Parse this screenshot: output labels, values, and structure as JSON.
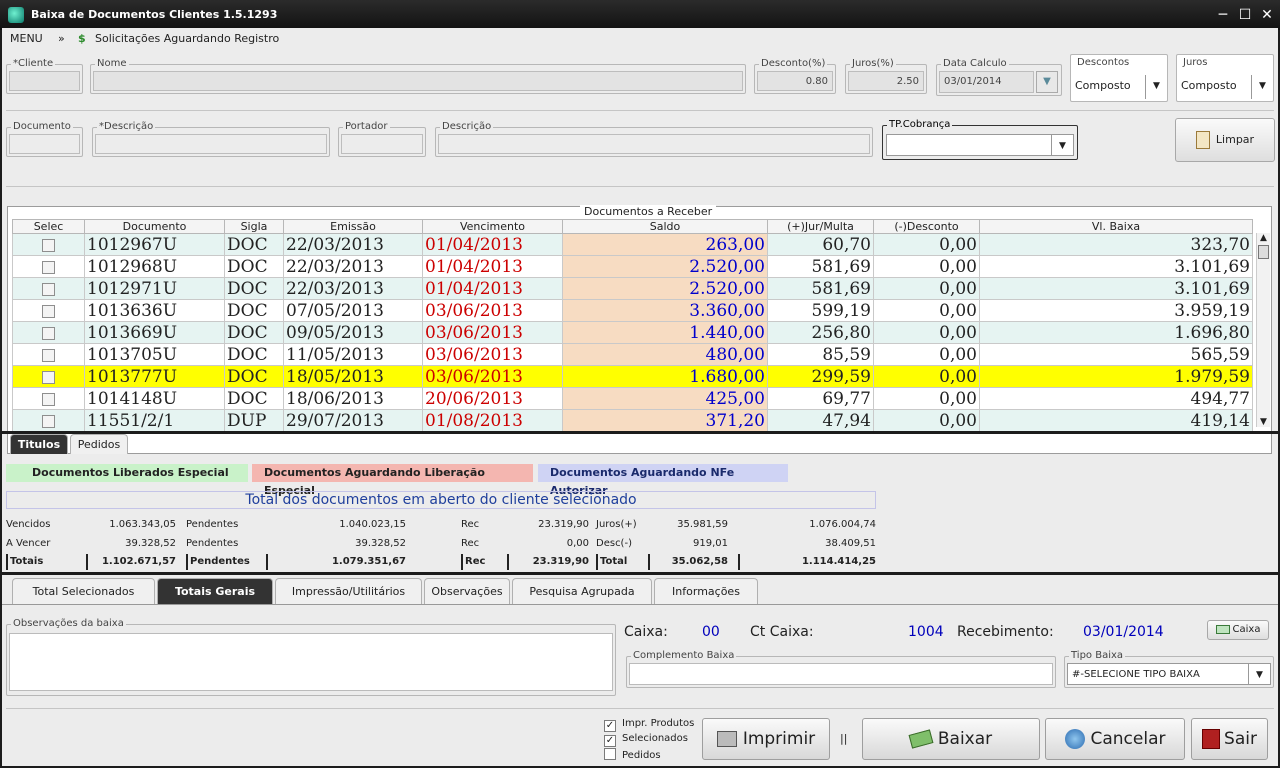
{
  "window": {
    "title": "Baixa de Documentos Clientes  1.5.1293",
    "minimize": "─",
    "maximize": "☐",
    "close": "✕"
  },
  "menu": {
    "menu_label": "MENU",
    "collapse_glyph": "»",
    "solicitacoes": "Solicitações Aguardando Registro"
  },
  "filters": {
    "cliente_label": "*Cliente",
    "cliente_value": "",
    "nome_label": "Nome",
    "nome_value": "",
    "desconto_label": "Desconto(%)",
    "desconto_value": "0.80",
    "juros_label": "Juros(%)",
    "juros_value": "2.50",
    "data_calculo_label": "Data Calculo",
    "data_calculo_value": "03/01/2014",
    "descontos_label": "Descontos",
    "descontos_value": "Composto",
    "juros_tipo_label": "Juros",
    "juros_tipo_value": "Composto",
    "documento_label": "Documento",
    "descricao_req_label": "*Descrição",
    "portador_label": "Portador",
    "descricao_label": "Descrição",
    "tp_cobranca_label": "TP.Cobrança",
    "tp_cobranca_value": "",
    "limpar_label": "Limpar"
  },
  "grid": {
    "title": "Documentos a Receber",
    "columns": [
      "Selec",
      "Documento",
      "Sigla",
      "Emissão",
      "Vencimento",
      "Saldo",
      "(+)Jur/Multa",
      "(-)Desconto",
      "Vl. Baixa"
    ],
    "rows": [
      [
        "1012967U",
        "DOC",
        "22/03/2013",
        "01/04/2013",
        "263,00",
        "60,70",
        "0,00",
        "323,70"
      ],
      [
        "1012968U",
        "DOC",
        "22/03/2013",
        "01/04/2013",
        "2.520,00",
        "581,69",
        "0,00",
        "3.101,69"
      ],
      [
        "1012971U",
        "DOC",
        "22/03/2013",
        "01/04/2013",
        "2.520,00",
        "581,69",
        "0,00",
        "3.101,69"
      ],
      [
        "1013636U",
        "DOC",
        "07/05/2013",
        "03/06/2013",
        "3.360,00",
        "599,19",
        "0,00",
        "3.959,19"
      ],
      [
        "1013669U",
        "DOC",
        "09/05/2013",
        "03/06/2013",
        "1.440,00",
        "256,80",
        "0,00",
        "1.696,80"
      ],
      [
        "1013705U",
        "DOC",
        "11/05/2013",
        "03/06/2013",
        "480,00",
        "85,59",
        "0,00",
        "565,59"
      ],
      [
        "1013777U",
        "DOC",
        "18/05/2013",
        "03/06/2013",
        "1.680,00",
        "299,59",
        "0,00",
        "1.979,59"
      ],
      [
        "1014148U",
        "DOC",
        "18/06/2013",
        "20/06/2013",
        "425,00",
        "69,77",
        "0,00",
        "494,77"
      ],
      [
        "11551/2/1",
        "DUP",
        "29/07/2013",
        "01/08/2013",
        "371,20",
        "47,94",
        "0,00",
        "419,14"
      ]
    ],
    "selected_row": 6
  },
  "sub_tabs": [
    "Titulos",
    "Pedidos"
  ],
  "legend": {
    "liberados": "Documentos Liberados Especial",
    "aguardando": "Documentos Aguardando Liberação Especial",
    "nfe": "Documentos Aguardando NFe Autorizar",
    "colors": {
      "liberados": "#c9f2c9",
      "aguardando": "#f4b6b0",
      "nfe": "#cfd3f4"
    }
  },
  "totals": {
    "title": "Total dos documentos em aberto do cliente selecionado",
    "rows": [
      {
        "label": "Vencidos",
        "v1": "1.063.343,05",
        "p_label": "Pendentes",
        "p": "1.040.023,15",
        "rec_label": "Rec",
        "rec": "23.319,90",
        "j_label": "Juros(+)",
        "j": "35.981,59",
        "t": "1.076.004,74"
      },
      {
        "label": "A Vencer",
        "v1": "39.328,52",
        "p_label": "Pendentes",
        "p": "39.328,52",
        "rec_label": "Rec",
        "rec": "0,00",
        "j_label": "Desc(-)",
        "j": "919,01",
        "t": "38.409,51"
      },
      {
        "label": "Totais",
        "v1": "1.102.671,57",
        "p_label": "Pendentes",
        "p": "1.079.351,67",
        "rec_label": "Rec",
        "rec": "23.319,90",
        "j_label": "Total",
        "j": "35.062,58",
        "t": "1.114.414,25"
      }
    ]
  },
  "bottom_tabs": [
    "Total Selecionados",
    "Totais Gerais",
    "Impressão/Utilitários",
    "Observações",
    "Pesquisa Agrupada",
    "Informações"
  ],
  "bottom": {
    "obs_label": "Observações da baixa",
    "caixa_label": "Caixa:",
    "caixa_value": "00",
    "ct_caixa_label": "Ct Caixa:",
    "ct_caixa_value": "1004",
    "recebimento_label": "Recebimento:",
    "recebimento_value": "03/01/2014",
    "caixa_btn": "Caixa",
    "complemento_label": "Complemento Baixa",
    "tipo_baixa_label": "Tipo Baixa",
    "tipo_baixa_value": "#-SELECIONE TIPO BAIXA"
  },
  "footer": {
    "impr_produtos": "Impr. Produtos",
    "selecionados": "Selecionados",
    "pedidos": "Pedidos",
    "imprimir": "Imprimir",
    "divider": "||",
    "baixar": "Baixar",
    "cancelar": "Cancelar",
    "sair": "Sair"
  }
}
